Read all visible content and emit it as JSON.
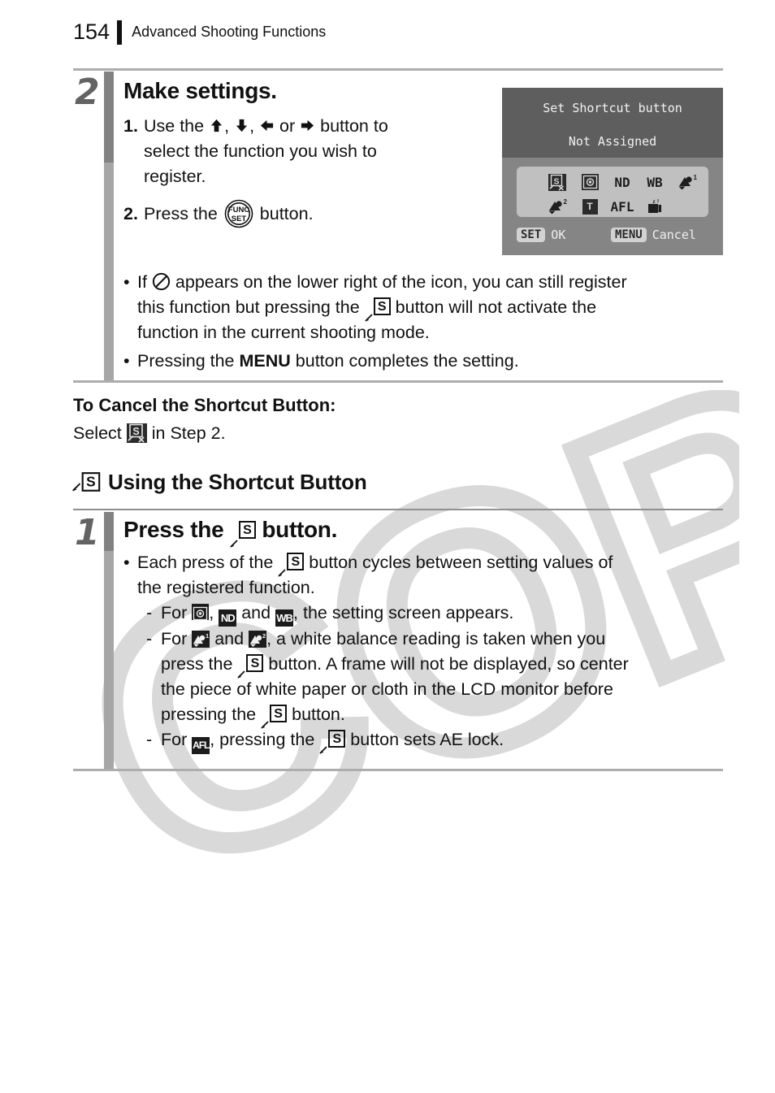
{
  "header": {
    "page_number": "154",
    "chapter": "Advanced Shooting Functions"
  },
  "step2": {
    "number": "2",
    "title": "Make settings.",
    "items": [
      {
        "marker": "1.",
        "text_before": "Use the",
        "icons": [
          "arrow-up-icon",
          "arrow-down-icon",
          "arrow-left-icon",
          "arrow-right-icon"
        ],
        "text_after": "button to select the function you wish to register.",
        "line1_tail": "button to",
        "line2": "select the function you wish to",
        "line3": "register.",
        "separator_comma": ",",
        "or_word": "or"
      },
      {
        "marker": "2.",
        "text_before": "Press the",
        "icon": "func-set-button-icon",
        "text_after": "button."
      }
    ],
    "notes": [
      {
        "bullet": "•",
        "part1": "If",
        "icon": "prohibition-circle-icon",
        "part2": "appears on the lower right of the icon, you can still register",
        "part3": "this function but pressing the",
        "icon2": "shortcut-button-icon",
        "part4": "button will not activate the",
        "part5": "function in the current shooting mode."
      },
      {
        "bullet": "•",
        "part1": "Pressing the",
        "bold_word": "MENU",
        "part2": "button completes the setting."
      }
    ]
  },
  "lcd": {
    "title": "Set Shortcut button",
    "subtitle": "Not Assigned",
    "icon_rows": [
      [
        "shortcut-off-icon",
        "spot-metering-icon",
        "nd-filter-icon",
        "white-balance-icon",
        "custom-wb-1-icon"
      ],
      [
        "custom-wb-2-icon",
        "digital-tele-converter-icon",
        "af-lock-icon",
        "display-off-icon"
      ]
    ],
    "icon_labels": {
      "nd-filter-icon": "ND",
      "white-balance-icon": "WB",
      "af-lock-icon": "AFL",
      "digital-tele-converter-icon": "T",
      "custom-wb-1-icon": "1",
      "custom-wb-2-icon": "2"
    },
    "footer": {
      "set_key": "SET",
      "set_label": "OK",
      "menu_key": "MENU",
      "menu_label": "Cancel"
    }
  },
  "cancel_section": {
    "heading": "To Cancel the Shortcut Button:",
    "text_before": "Select",
    "icon": "shortcut-off-icon",
    "text_after": "in Step 2."
  },
  "section": {
    "icon": "shortcut-button-icon",
    "title": "Using the Shortcut Button"
  },
  "step1": {
    "number": "1",
    "title_before": "Press the",
    "title_icon": "shortcut-button-icon",
    "title_after": "button.",
    "bullet": {
      "marker": "•",
      "part1": "Each press of the",
      "icon": "shortcut-button-icon",
      "part2": "button cycles between setting values of",
      "part3": "the registered function."
    },
    "sub_items": [
      {
        "marker": "-",
        "part1": "For",
        "icon1": "spot-metering-icon",
        "comma": ",",
        "icon2": "nd-filter-icon",
        "and": "and",
        "icon3": "white-balance-icon",
        "part2": ", the setting screen appears."
      },
      {
        "marker": "-",
        "part1": "For",
        "icon1": "custom-wb-1-icon",
        "and": "and",
        "icon2": "custom-wb-2-icon",
        "part2": ", a white balance reading is taken when you",
        "part3": "press the",
        "icon3": "shortcut-button-icon",
        "part4": "button. A frame will not be displayed, so center",
        "part5": "the piece of white paper or cloth in the LCD monitor before",
        "part6": "pressing the",
        "icon4": "shortcut-button-icon",
        "part7": "button."
      },
      {
        "marker": "-",
        "part1": "For",
        "icon1": "af-lock-icon",
        "part2": ", pressing the",
        "icon2": "shortcut-button-icon",
        "part3": "button sets AE lock."
      }
    ]
  },
  "watermark": {
    "text": "COPY"
  },
  "colors": {
    "rule": "#adadad",
    "step_number": "#636363",
    "bar_dark": "#828282",
    "bar_light": "#a6a6a6",
    "lcd_top": "#5e5e5e",
    "lcd_bottom": "#858585",
    "lcd_panel": "#c0c0c0",
    "icon_dark": "#1c1c1c"
  }
}
